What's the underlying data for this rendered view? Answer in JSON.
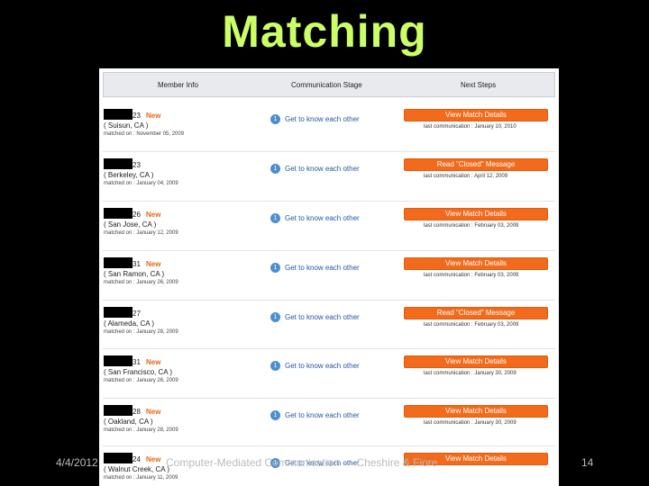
{
  "slide": {
    "title": "Matching",
    "footer_date": "4/4/2012",
    "footer_text": "Computer-Mediated Communication — Cheshire & Fiore",
    "page_number": "14"
  },
  "table": {
    "headers": [
      "Member Info",
      "Communication Stage",
      "Next Steps"
    ]
  },
  "rows": [
    {
      "age": "23",
      "new": "New",
      "city": "( Suisun, CA )",
      "matched": "matched on : November 05, 2009",
      "stage_num": "1",
      "stage": "Get to know each other",
      "action": "View Match Details",
      "last": "last communication : January 10, 2010"
    },
    {
      "age": "23",
      "new": "",
      "city": "( Berkeley, CA )",
      "matched": "matched on : January 04, 2009",
      "stage_num": "1",
      "stage": "Get to know each other",
      "action": "Read \"Closed\" Message",
      "last": "last communication : April 12, 2009"
    },
    {
      "age": "26",
      "new": "New",
      "city": "( San Jose, CA )",
      "matched": "matched on : January 12, 2009",
      "stage_num": "1",
      "stage": "Get to know each other",
      "action": "View Match Details",
      "last": "last communication : February 03, 2009"
    },
    {
      "age": "31",
      "new": "New",
      "city": "( San Ramon, CA )",
      "matched": "matched on : January 26, 2009",
      "stage_num": "1",
      "stage": "Get to know each other",
      "action": "View Match Details",
      "last": "last communication : February 03, 2009"
    },
    {
      "age": "27",
      "new": "",
      "city": "( Alameda, CA )",
      "matched": "matched on : January 28, 2009",
      "stage_num": "1",
      "stage": "Get to know each other",
      "action": "Read \"Closed\" Message",
      "last": "last communication : February 03, 2009"
    },
    {
      "age": "31",
      "new": "New",
      "city": "( San Francisco, CA )",
      "matched": "matched on : January 26, 2009",
      "stage_num": "1",
      "stage": "Get to know each other",
      "action": "View Match Details",
      "last": "last communication : January 30, 2009"
    },
    {
      "age": "28",
      "new": "New",
      "city": "( Oakland, CA )",
      "matched": "matched on : January 28, 2009",
      "stage_num": "1",
      "stage": "Get to know each other",
      "action": "View Match Details",
      "last": "last communication : January 30, 2009"
    },
    {
      "age": "24",
      "new": "New",
      "city": "( Walnut Creek, CA )",
      "matched": "matched on : January 11, 2009",
      "stage_num": "1",
      "stage": "Get to know each other",
      "action": "View Match Details",
      "last": ""
    }
  ]
}
